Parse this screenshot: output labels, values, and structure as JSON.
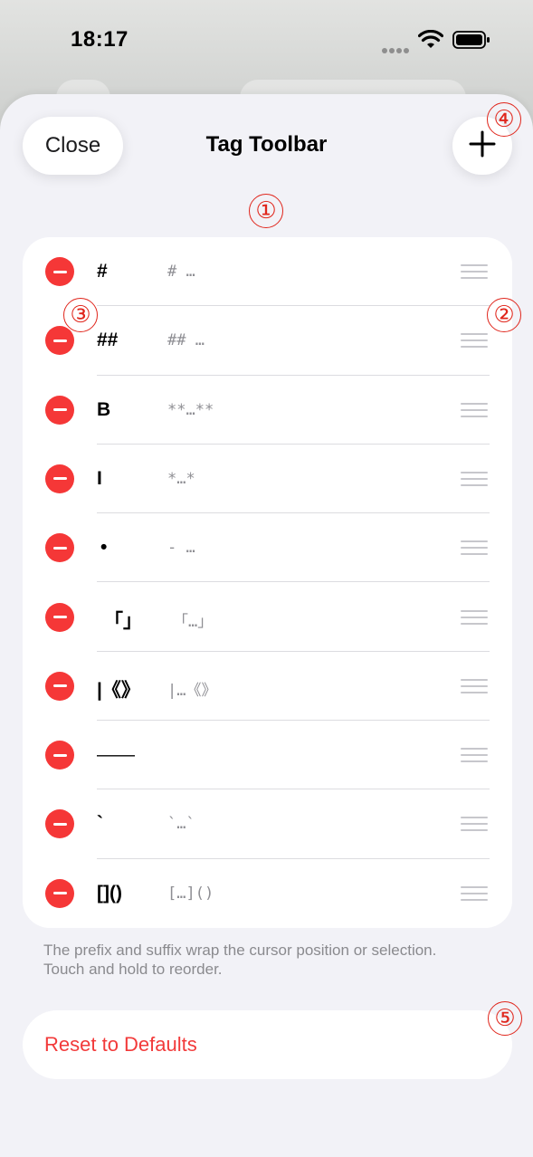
{
  "status": {
    "time": "18:17"
  },
  "header": {
    "close_label": "Close",
    "title": "Tag Toolbar",
    "add_icon": "plus-icon"
  },
  "tags": [
    {
      "label": "#",
      "preview": "# …"
    },
    {
      "label": "##",
      "preview": "## …"
    },
    {
      "label": "B",
      "preview": "**…**"
    },
    {
      "label": "I",
      "preview": "*…*"
    },
    {
      "label": "•",
      "preview": "- …"
    },
    {
      "label": "「」",
      "preview": "「…」"
    },
    {
      "label": "|《》",
      "preview": "|…《》"
    },
    {
      "label": "——",
      "preview": ""
    },
    {
      "label": "`",
      "preview": "`…`"
    },
    {
      "label": "[]()",
      "preview": "[…]()"
    }
  ],
  "footer_note": "The prefix and suffix wrap the cursor position or selection. Touch and hold to reorder.",
  "reset_label": "Reset to Defaults",
  "annotations": [
    "①",
    "②",
    "③",
    "④",
    "⑤"
  ],
  "colors": {
    "accent_red": "#f53737",
    "annotation_red": "#e0261c",
    "sheet_bg": "#f2f2f7"
  }
}
